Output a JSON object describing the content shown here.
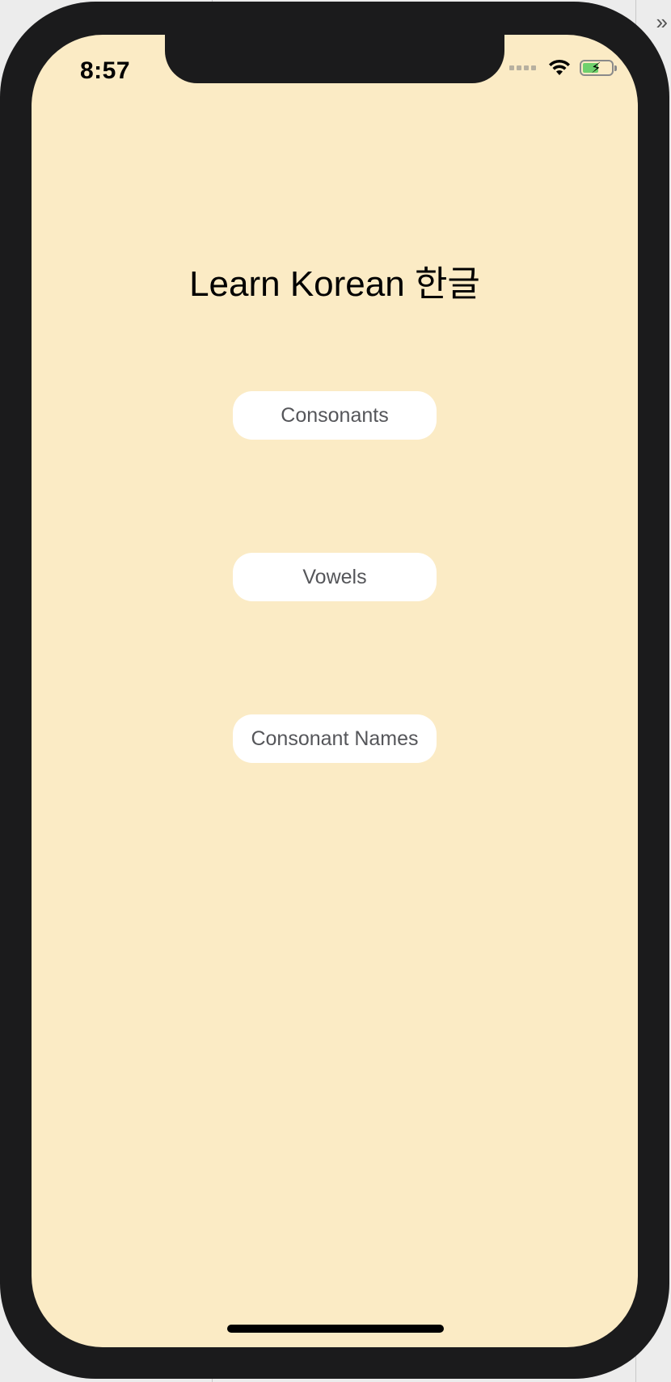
{
  "status_bar": {
    "time": "8:57"
  },
  "app": {
    "title": "Learn Korean  한글",
    "buttons": [
      {
        "label": "Consonants"
      },
      {
        "label": "Vowels"
      },
      {
        "label": "Consonant Names"
      }
    ]
  },
  "colors": {
    "screen_background": "#fbebc5",
    "button_background": "#ffffff",
    "button_text": "#55565a",
    "device_frame": "#1b1b1c",
    "battery_fill": "#6fd06d"
  },
  "icons": [
    "wifi-icon",
    "battery-charging-icon",
    "cellular-signal-icon",
    "chevron-double-right-icon"
  ]
}
